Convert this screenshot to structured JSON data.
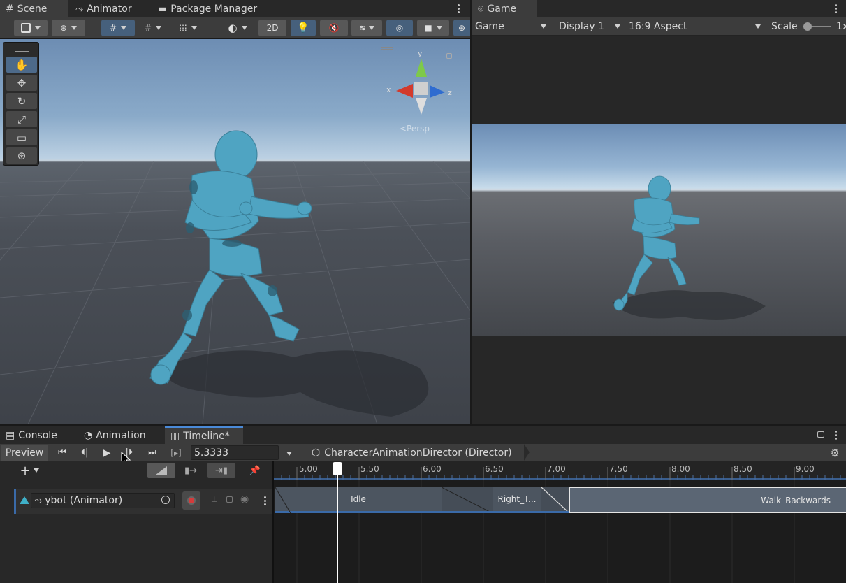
{
  "top_tabs": {
    "scene": "Scene",
    "animator": "Animator",
    "package_manager": "Package Manager",
    "game": "Game"
  },
  "scene_toolbar": {
    "btn_2d": "2D"
  },
  "gizmo": {
    "y": "y",
    "x": "x",
    "z": "z",
    "persp": "<Persp"
  },
  "game_toolbar": {
    "display_mode": "Game",
    "display": "Display 1",
    "aspect": "16:9 Aspect",
    "scale_label": "Scale",
    "scale_value": "1x"
  },
  "bottom_tabs": {
    "console": "Console",
    "animation": "Animation",
    "timeline": "Timeline*"
  },
  "timeline": {
    "preview_label": "Preview",
    "frame_value": "5.3333",
    "director": "CharacterAnimationDirector (Director)",
    "ruler": [
      "5.00",
      "5.50",
      "6.00",
      "6.50",
      "7.00",
      "7.50",
      "8.00",
      "8.50",
      "9.00"
    ],
    "track_name": "ybot (Animator)",
    "clips": {
      "idle": "Idle",
      "right_turn": "Right_T...",
      "walk_backwards": "Walk_Backwards"
    }
  },
  "colors": {
    "accent": "#4a8ad8",
    "record": "#d43b3b",
    "playhead": "#ffffff",
    "clip_fill": "#4c5560"
  }
}
